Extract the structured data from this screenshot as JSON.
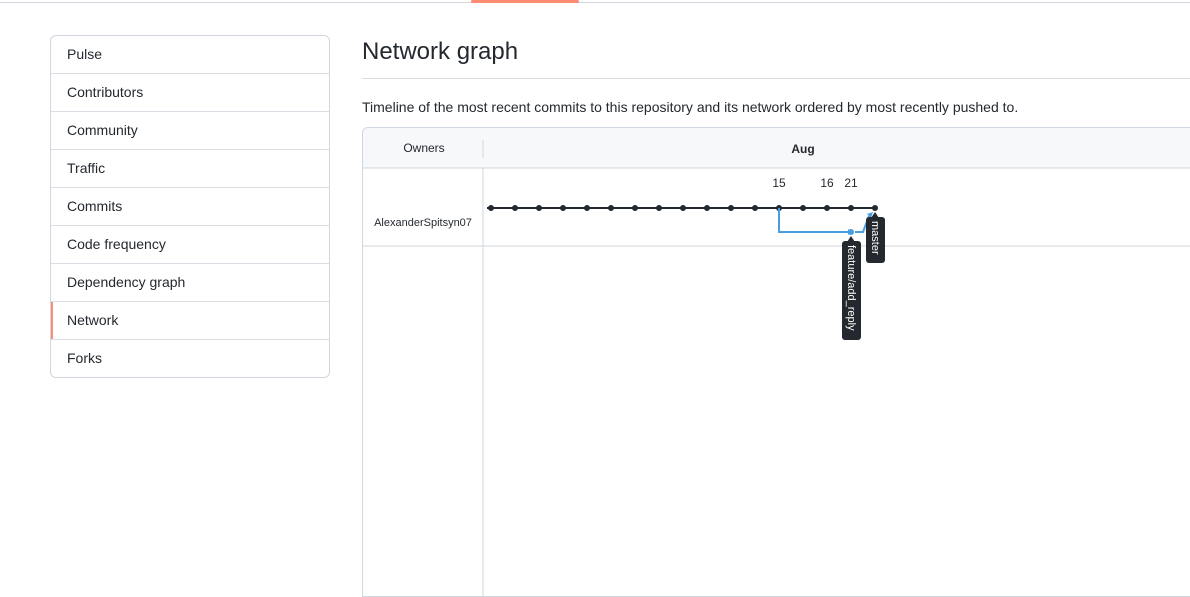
{
  "sidebar": {
    "items": [
      {
        "label": "Pulse"
      },
      {
        "label": "Contributors"
      },
      {
        "label": "Community"
      },
      {
        "label": "Traffic"
      },
      {
        "label": "Commits"
      },
      {
        "label": "Code frequency"
      },
      {
        "label": "Dependency graph"
      },
      {
        "label": "Network",
        "selected": true
      },
      {
        "label": "Forks"
      }
    ]
  },
  "main": {
    "title": "Network graph",
    "description": "Timeline of the most recent commits to this repository and its network ordered by most recently pushed to."
  },
  "network": {
    "owners_header": "Owners",
    "month_label": "Aug",
    "date_labels": [
      "15",
      "16",
      "21"
    ],
    "owner": "AlexanderSpitsyn07",
    "branches": [
      {
        "name": "master",
        "color": "#24292f"
      },
      {
        "name": "feature/add_reply",
        "color": "#4a9ee0"
      }
    ],
    "master_commit_count": 17
  },
  "colors": {
    "accent": "#fd8c73",
    "branch": "#4a9ee0",
    "commit": "#24292f",
    "tag_bg": "#24292f",
    "header_bg": "#f6f8fa"
  }
}
